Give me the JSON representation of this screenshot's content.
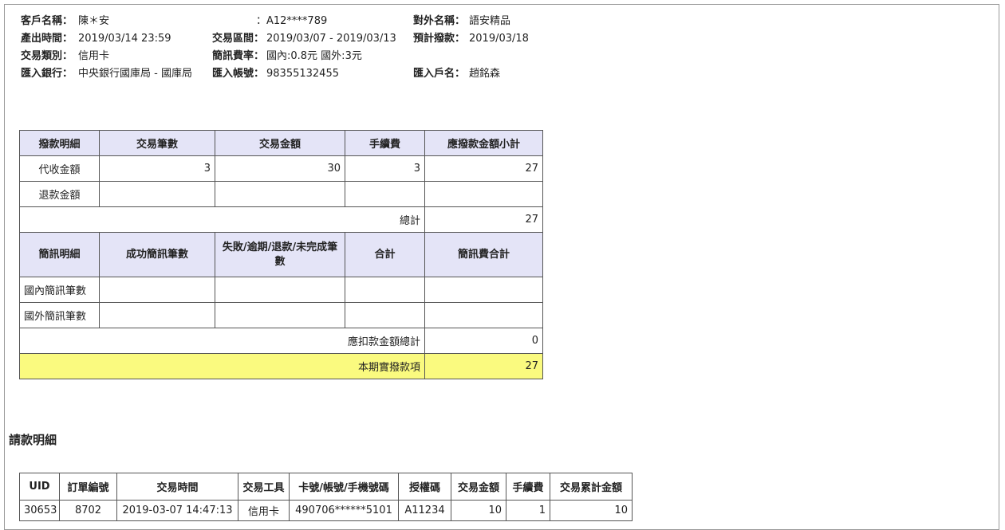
{
  "header_info": {
    "customer_name_label": "客戶名稱：",
    "customer_name_value": "陳＊安",
    "id_sep": "：",
    "id_value": "A12****789",
    "shop_name_label": "對外名稱：",
    "shop_name_value": "語安精品",
    "produced_label": "產出時間：",
    "produced_value": "2019/03/14 23:59",
    "period_label": "交易區間：",
    "period_value": "2019/03/07 - 2019/03/13",
    "expected_label": "預計撥款：",
    "expected_value": "2019/03/18",
    "txn_type_label": "交易類別：",
    "txn_type_value": "信用卡",
    "sms_rate_label": "簡訊費率：",
    "sms_rate_value": "國內:0.8元 國外:3元",
    "bank_label": "匯入銀行：",
    "bank_value": "中央銀行國庫局 - 國庫局",
    "account_label": "匯入帳號：",
    "account_value": "98355132455",
    "holder_label": "匯入戶名：",
    "holder_value": "趙銘森"
  },
  "summary": {
    "payout_headers": [
      "撥款明細",
      "交易筆數",
      "交易金額",
      "手續費",
      "應撥款金額小計"
    ],
    "collect_row": {
      "label": "代收金額",
      "count": "3",
      "amount": "30",
      "fee": "3",
      "subtotal": "27"
    },
    "refund_row": {
      "label": "退款金額"
    },
    "total_label": "總計",
    "total_value": "27",
    "sms_headers": [
      "簡訊明細",
      "成功簡訊筆數",
      "失敗/逾期/退款/未完成筆數",
      "合計",
      "簡訊費合計"
    ],
    "sms_domestic_label": "國內簡訊筆數",
    "sms_foreign_label": "國外簡訊筆數",
    "deduct_label": "應扣款金額總計",
    "deduct_value": "0",
    "actual_label": "本期實撥款項",
    "actual_value": "27"
  },
  "detail": {
    "title": "請款明細",
    "headers": [
      "UID",
      "訂單編號",
      "交易時間",
      "交易工具",
      "卡號/帳號/手機號碼",
      "授權碼",
      "交易金額",
      "手續費",
      "交易累計金額"
    ],
    "row": [
      "30653",
      "8702",
      "2019-03-07 14:47:13",
      "信用卡",
      "490706******5101",
      "A11234",
      "10",
      "1",
      "10"
    ]
  }
}
